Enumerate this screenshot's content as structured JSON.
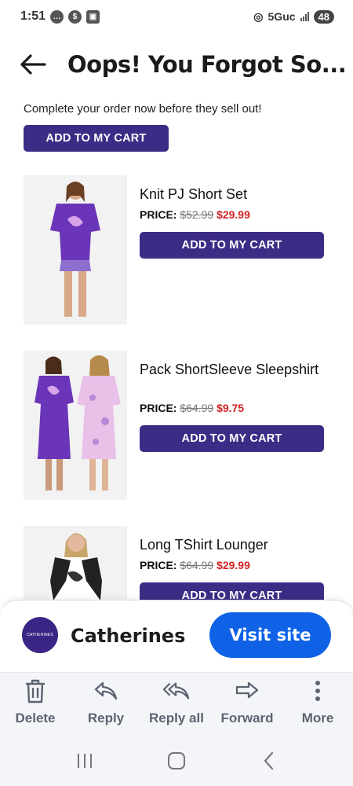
{
  "status_bar": {
    "time": "1:51",
    "network": "5Guc",
    "battery": "48"
  },
  "header": {
    "title": "Oops! You Forgot So..."
  },
  "intro_text": "Complete your order now before they sell out!",
  "cta_label": "ADD TO MY CART",
  "price_label": "PRICE:",
  "products": [
    {
      "name": "Knit PJ Short Set",
      "old_price": "$52.99",
      "new_price": "$29.99",
      "button": "ADD TO MY CART"
    },
    {
      "name": "Pack ShortSleeve Sleepshirt",
      "old_price": "$64.99",
      "new_price": "$9.75",
      "button": "ADD TO MY CART"
    },
    {
      "name": "Long TShirt Lounger",
      "old_price": "$64.99",
      "new_price": "$29.99",
      "button": "ADD TO MY CART"
    }
  ],
  "sender": {
    "name": "Catherines",
    "logo_text": "CATHERINES",
    "visit_label": "Visit site"
  },
  "toolbar": {
    "delete": "Delete",
    "reply": "Reply",
    "reply_all": "Reply all",
    "forward": "Forward",
    "more": "More"
  },
  "colors": {
    "brand_purple": "#3d2c86",
    "sale_red": "#d32222",
    "visit_blue": "#0f62e6"
  },
  "icons": [
    "back-arrow-icon",
    "trash-icon",
    "reply-icon",
    "reply-all-icon",
    "forward-icon",
    "more-vertical-icon",
    "recent-apps-icon",
    "home-icon",
    "back-nav-icon"
  ]
}
